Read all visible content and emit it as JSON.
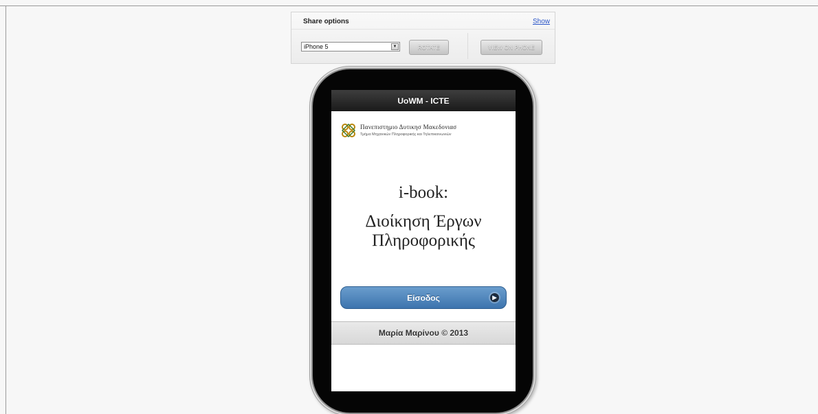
{
  "share": {
    "title": "Share options",
    "show_link": "Show",
    "device_selected": "iPhone 5",
    "rotate_label": "ROTATE",
    "view_label": "VIEW ON PHONE"
  },
  "app": {
    "header_title": "UoWM - ICTE",
    "university": "Πανεπιστημιο Δυτικησ Μακεδονιασ",
    "department": "Τμήμα Μηχανικών Πληροφορικής και Τηλεπικοινωνιών",
    "ibook_title": "i-book:",
    "course_line1": "Διοίκηση Έργων",
    "course_line2": "Πληροφορικής",
    "enter_label": "Είσοδος",
    "footer_text": "Μαρία Μαρίνου © 2013"
  },
  "colors": {
    "accent": "#4a80ba",
    "header_bg": "#2a2a2a",
    "link": "#2a55c8"
  },
  "icons": {
    "logo": "university-knot-logo",
    "select_arrow": "chevron-down-icon",
    "enter_arrow": "arrow-right-icon"
  }
}
